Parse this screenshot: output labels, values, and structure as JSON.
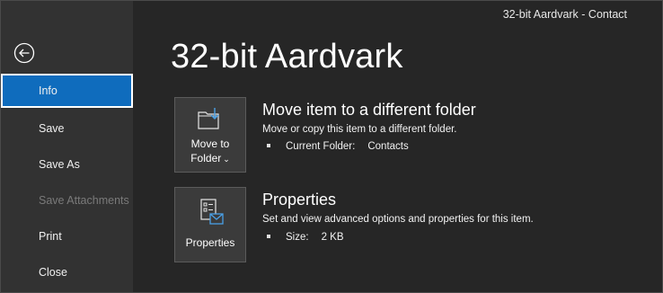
{
  "window": {
    "title": "32-bit Aardvark  -  Contact"
  },
  "sidebar": {
    "items": [
      {
        "label": "Info",
        "state": "active"
      },
      {
        "label": "Save",
        "state": "normal"
      },
      {
        "label": "Save As",
        "state": "normal"
      },
      {
        "label": "Save Attachments",
        "state": "disabled"
      },
      {
        "label": "Print",
        "state": "normal"
      },
      {
        "label": "Close",
        "state": "normal"
      }
    ]
  },
  "main": {
    "title": "32-bit Aardvark",
    "move": {
      "button_line1": "Move to",
      "button_line2": "Folder",
      "heading": "Move item to a different folder",
      "description": "Move or copy this item to a different folder.",
      "detail_label": "Current Folder:",
      "detail_value": "Contacts"
    },
    "properties": {
      "button_label": "Properties",
      "heading": "Properties",
      "description": "Set and view advanced options and properties for this item.",
      "detail_label": "Size:",
      "detail_value": "2 KB"
    }
  },
  "colors": {
    "accent": "#0f6cbd",
    "background": "#262626",
    "sidebar": "#323232"
  }
}
